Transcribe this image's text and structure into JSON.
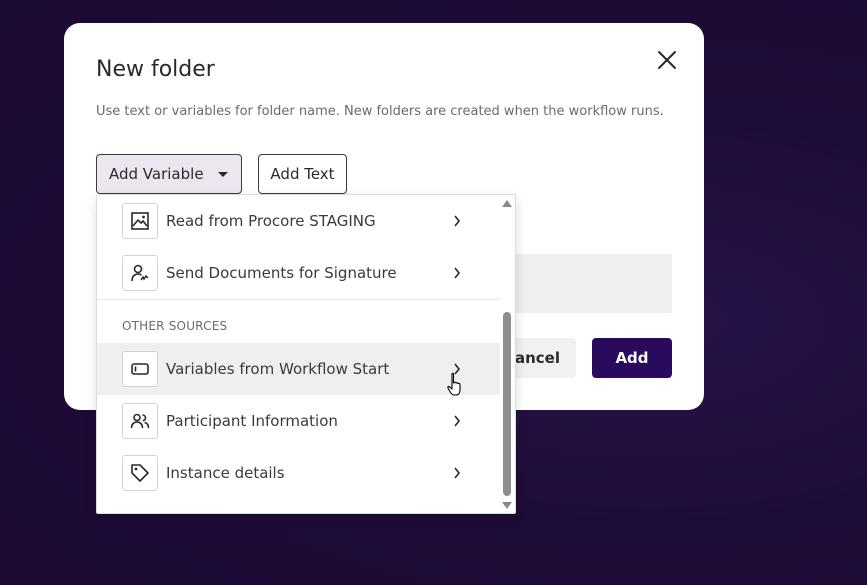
{
  "modal": {
    "title": "New folder",
    "description": "Use text or variables for folder name. New folders are created when the workflow runs.",
    "add_variable_label": "Add Variable",
    "add_text_label": "Add Text",
    "cancel_label": "Cancel",
    "add_label": "Add"
  },
  "dropdown": {
    "items_top": [
      {
        "label": "Read from Procore STAGING",
        "icon": "image-icon"
      },
      {
        "label": "Send Documents for Signature",
        "icon": "person-signature-icon"
      }
    ],
    "section_header": "OTHER SOURCES",
    "items_other": [
      {
        "label": "Variables from Workflow Start",
        "icon": "input-box-icon",
        "hovered": true
      },
      {
        "label": "Participant Information",
        "icon": "people-icon"
      },
      {
        "label": "Instance details",
        "icon": "tag-icon"
      }
    ]
  },
  "colors": {
    "primary": "#2a0a5c",
    "backdrop": "#1f0d3a",
    "hover": "#efefef"
  }
}
